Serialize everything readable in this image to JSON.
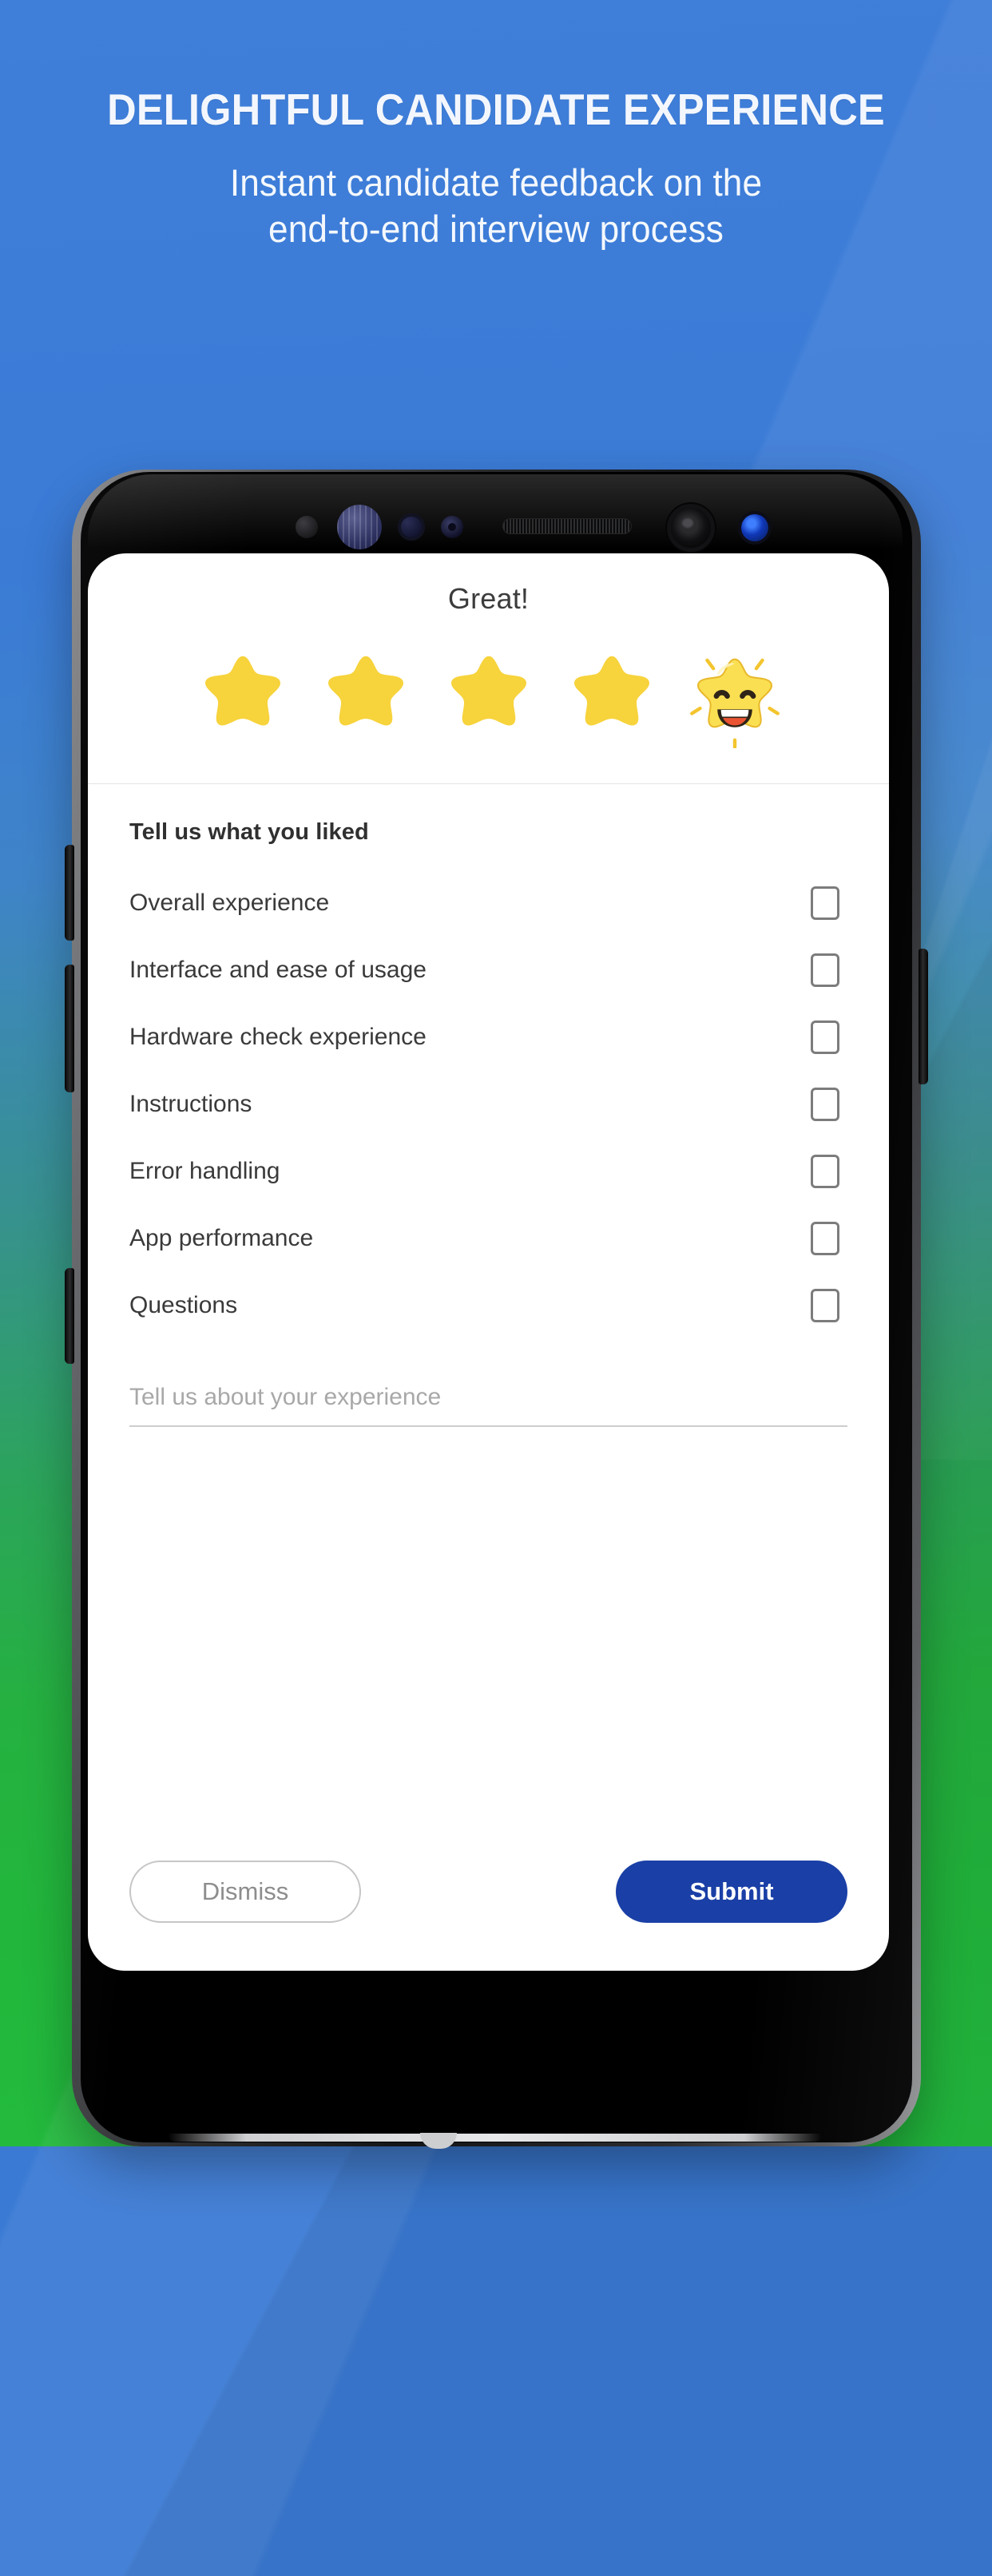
{
  "hero": {
    "title": "DELIGHTFUL CANDIDATE EXPERIENCE",
    "subtitle_line1": "Instant candidate feedback on the",
    "subtitle_line2": "end-to-end interview process"
  },
  "colors": {
    "background_top": "#3f7ed9",
    "background_bottom": "#22b73c",
    "star_fill": "#f7d33c",
    "submit_blue": "#1a3fa6",
    "heading_text": "#303030"
  },
  "phone": {
    "sensors": [
      "ir-sensor-icon",
      "iris-scanner-icon",
      "proximity-sensor-icon",
      "notification-led-icon",
      "earpiece-speaker-icon",
      "front-camera-icon",
      "status-led-icon"
    ],
    "side_buttons": [
      "volume-up-button",
      "volume-down-button",
      "bixby-button",
      "power-button"
    ]
  },
  "app": {
    "rating": {
      "title": "Great!",
      "value": 5,
      "max": 5,
      "stars": [
        {
          "index": 1,
          "type": "plain",
          "filled": true
        },
        {
          "index": 2,
          "type": "plain",
          "filled": true
        },
        {
          "index": 3,
          "type": "plain",
          "filled": true
        },
        {
          "index": 4,
          "type": "plain",
          "filled": true
        },
        {
          "index": 5,
          "type": "happy-face",
          "filled": true
        }
      ]
    },
    "form": {
      "heading": "Tell us what you liked",
      "options": [
        {
          "label": "Overall experience",
          "checked": false
        },
        {
          "label": "Interface and ease of usage",
          "checked": false
        },
        {
          "label": "Hardware check experience",
          "checked": false
        },
        {
          "label": "Instructions",
          "checked": false
        },
        {
          "label": "Error handling",
          "checked": false
        },
        {
          "label": "App performance",
          "checked": false
        },
        {
          "label": "Questions",
          "checked": false
        }
      ],
      "comment": {
        "value": "",
        "placeholder": "Tell us about your experience"
      }
    },
    "actions": {
      "dismiss_label": "Dismiss",
      "submit_label": "Submit"
    }
  }
}
